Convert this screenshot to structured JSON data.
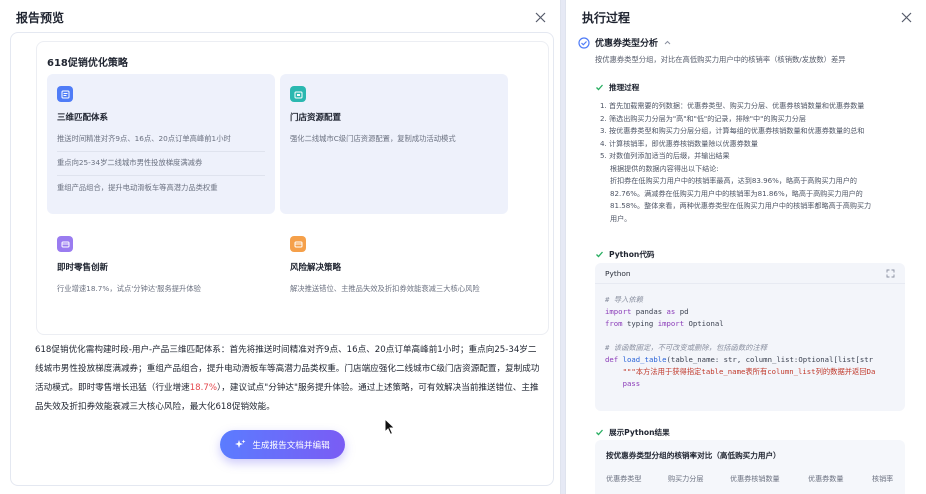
{
  "left_panel": {
    "title": "报告预览",
    "strategy": {
      "title": "618促销优化策略",
      "blocks": [
        {
          "name": "三维匹配体系",
          "icon": "document-icon",
          "color": "#4f7cf7",
          "lines": [
            "推送时间精准对齐9点、16点、20点订单高峰前1小时",
            "重点向25-34岁二线城市男性投放梯度满减券",
            "重组产品组合，提升电动滑板车等高潜力品类权重"
          ]
        },
        {
          "name": "门店资源配置",
          "icon": "store-icon",
          "color": "#2bb8b0",
          "lines": [
            "强化二线城市C级门店资源配置，复制成功活动模式"
          ]
        },
        {
          "name": "即时零售创新",
          "icon": "cart-icon",
          "color": "#9a7cf0",
          "lines": [
            "行业增速18.7%，试点'分钟达'服务提升体验"
          ]
        },
        {
          "name": "风险解决策略",
          "icon": "shield-icon",
          "color": "#f5a04a",
          "lines": [
            "解决推送错位、主推品失效及折扣券效能衰减三大核心风险"
          ]
        }
      ]
    },
    "report_text": {
      "part1": "618促销优化需构建时段-用户-产品三维匹配体系：首先将推送时间精准对齐9点、16点、20点订单高峰前1小时；重点向25-34岁二线城市男性投放梯度满减券；重组产品组合，提升电动滑板车等高潜力品类权重。门店端应强化二线城市C级门店资源配置，复制成功活动模式。即时零售增长迅猛（行业增速",
      "highlight": "18.7%",
      "part2": "），建议试点\"分钟达\"服务提升体验。通过上述策略，可有效解决当前推送错位、主推品失效及折扣券效能衰减三大核心风险，最大化618促销效能。"
    },
    "generate_button": "生成报告文档并编辑"
  },
  "right_panel": {
    "title": "执行过程",
    "step": {
      "title": "优惠券类型分析",
      "desc": "按优惠券类型分组，对比在高低购买力用户中的核销率（核销数/发放数）差异"
    },
    "reasoning": {
      "label": "推理过程",
      "items": [
        "1. 首先加载需要的列数据：优惠券类型、购买力分层、优惠券核销数量和优惠券数量",
        "2. 筛选出购买力分层为\"高\"和\"低\"的记录，排除\"中\"的购买力分层",
        "3. 按优惠券类型和购买力分层分组，计算每组的优惠券核销数量和优惠券数量的总和",
        "4. 计算核销率，即优惠券核销数量除以优惠券数量",
        "5. 对数值列添加适当的后缀，并输出结果"
      ],
      "conclusion": [
        "根据提供的数据内容得出以下结论:",
        "折扣券在低购买力用户中的核销率最高，达到83.96%，略高于高购买力用户的",
        "82.76%。满减券在低购买力用户中的核销率为81.86%，略高于高购买力用户的",
        "81.58%。整体来看，两种优惠券类型在低购买力用户中的核销率都略高于高购买力",
        "用户。"
      ]
    },
    "python": {
      "label": "Python代码",
      "lang": "Python",
      "code": {
        "c1": "# 导入依赖",
        "i1a": "import",
        "i1b": " pandas ",
        "i1c": "as",
        "i1d": " pd",
        "i2a": "from",
        "i2b": " typing ",
        "i2c": "import",
        "i2d": " Optional",
        "c2": "# 该函数固定，不可改变或删除，包括函数的注释",
        "d1": "def",
        "d2": "load_table",
        "d3": "(table_name: str, column_list:Optional[list[str",
        "doc": "\"\"\"本方法用于获得指定table_name表所有column_list列的数据并返回Da",
        "pass": "pass"
      }
    },
    "result": {
      "label": "展示Python结果",
      "title": "按优惠券类型分组的核销率对比（高低购买力用户）",
      "columns": [
        "优惠券类型",
        "购买力分层",
        "优惠券核销数量",
        "优惠券数量",
        "核销率"
      ]
    }
  }
}
